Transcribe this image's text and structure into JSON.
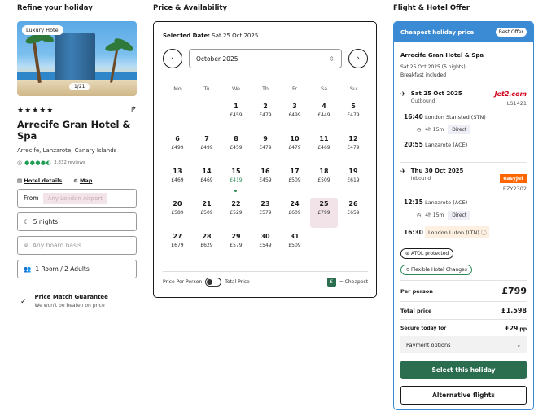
{
  "left": {
    "heading": "Refine your holiday",
    "badge": "Luxury Hotel",
    "pager": "1/21",
    "stars": "★★★★★",
    "hotel_name": "Arrecife Gran Hotel & Spa",
    "location": "Arrecife, Lanzarote, Canary Islands",
    "reviews": "3,832 reviews",
    "hotel_details_link": "Hotel details",
    "map_link": "Map",
    "from_label": "From",
    "from_value": "Any London Airport",
    "nights": "5 nights",
    "board_placeholder": "Any board basis",
    "rooms": "1 Room / 2 Adults",
    "guarantee_title": "Price Match Guarantee",
    "guarantee_sub": "We won't be beaten on price"
  },
  "calendar": {
    "heading": "Price & Availability",
    "selected_label": "Selected Date:",
    "selected_value": "Sat 25 Oct 2025",
    "month": "October 2025",
    "weekdays": [
      "Mo",
      "Tu",
      "We",
      "Th",
      "Fr",
      "Sa",
      "Su"
    ],
    "days": [
      {
        "n": "1",
        "p": "£459"
      },
      {
        "n": "2",
        "p": "£479"
      },
      {
        "n": "3",
        "p": "£499"
      },
      {
        "n": "4",
        "p": "£449"
      },
      {
        "n": "5",
        "p": "£479"
      },
      {
        "n": "6",
        "p": "£499"
      },
      {
        "n": "7",
        "p": "£499"
      },
      {
        "n": "8",
        "p": "£459"
      },
      {
        "n": "9",
        "p": "£479"
      },
      {
        "n": "10",
        "p": "£479"
      },
      {
        "n": "11",
        "p": "£469"
      },
      {
        "n": "12",
        "p": "£479"
      },
      {
        "n": "13",
        "p": "£469"
      },
      {
        "n": "14",
        "p": "£469"
      },
      {
        "n": "15",
        "p": "£419"
      },
      {
        "n": "16",
        "p": "£459"
      },
      {
        "n": "17",
        "p": "£509"
      },
      {
        "n": "18",
        "p": "£509"
      },
      {
        "n": "19",
        "p": "£619"
      },
      {
        "n": "20",
        "p": "£589"
      },
      {
        "n": "21",
        "p": "£509"
      },
      {
        "n": "22",
        "p": "£529"
      },
      {
        "n": "23",
        "p": "£579"
      },
      {
        "n": "24",
        "p": "£609"
      },
      {
        "n": "25",
        "p": "£799"
      },
      {
        "n": "26",
        "p": "£659"
      },
      {
        "n": "27",
        "p": "£679"
      },
      {
        "n": "28",
        "p": "£629"
      },
      {
        "n": "29",
        "p": "£579"
      },
      {
        "n": "30",
        "p": "£549"
      },
      {
        "n": "31",
        "p": "£509"
      }
    ],
    "price_per_person": "Price Per Person",
    "total_price": "Total Price",
    "cheapest_symbol": "£",
    "cheapest_label": "= Cheapest"
  },
  "offer": {
    "heading": "Flight & Hotel Offer",
    "banner": "Cheapest holiday price",
    "best_badge": "Best Offer",
    "hotel_name": "Arrecife Gran Hotel & Spa",
    "stay": "Sat 25 Oct 2025 (5 nights)",
    "board": "Breakfast included",
    "outbound": {
      "date": "Sat 25 Oct 2025",
      "dir": "Outbound",
      "airline": "Jet2.com",
      "code": "LS1421",
      "dep_time": "16:40",
      "dep_airport": "London Stansted (STN)",
      "duration": "4h 15m",
      "direct": "Direct",
      "arr_time": "20:55",
      "arr_airport": "Lanzarote (ACE)"
    },
    "inbound": {
      "date": "Thu 30 Oct 2025",
      "dir": "Inbound",
      "airline": "easyJet",
      "code": "EZY2302",
      "dep_time": "12:15",
      "dep_airport": "Lanzarote (ACE)",
      "duration": "4h 15m",
      "direct": "Direct",
      "arr_time": "16:30",
      "arr_airport": "London Luton (LTN)"
    },
    "atol": "ATOL protected",
    "flex": "Flexible Hotel Changes",
    "per_person_label": "Per person",
    "per_person_value": "£799",
    "total_label": "Total price",
    "total_value": "£1,598",
    "secure_label": "Secure today for",
    "secure_value": "£29",
    "secure_unit": "pp",
    "payment_options": "Payment options",
    "select_btn": "Select this holiday",
    "alt_btn": "Alternative flights"
  },
  "colors": {
    "accent_blue": "#3b8bd4",
    "primary_green": "#2b6e4f",
    "cheap_green": "#2e8b57",
    "selected_pink": "#f1e3e8"
  }
}
